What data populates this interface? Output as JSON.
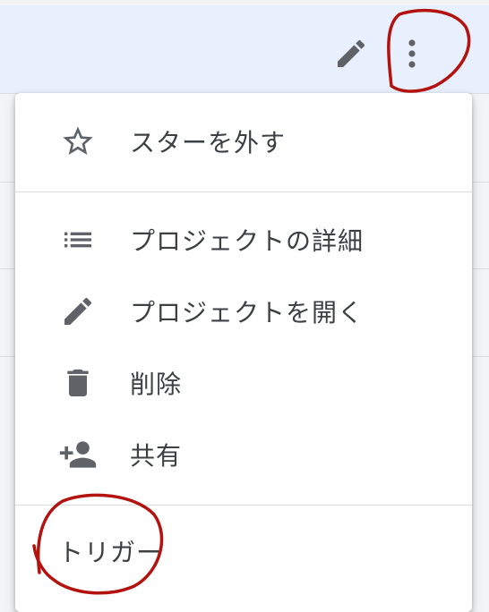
{
  "toolbar": {
    "edit_icon": "pencil-icon",
    "more_icon": "more-vert-icon"
  },
  "menu": {
    "items": [
      {
        "label": "スターを外す",
        "icon": "star-outline-icon"
      },
      {
        "label": "プロジェクトの詳細",
        "icon": "list-icon"
      },
      {
        "label": "プロジェクトを開く",
        "icon": "pencil-icon"
      },
      {
        "label": "削除",
        "icon": "trash-icon"
      },
      {
        "label": "共有",
        "icon": "person-add-icon"
      },
      {
        "label": "トリガー"
      }
    ]
  },
  "colors": {
    "accent_bg": "#e8f0fe",
    "icon": "#5f6368",
    "text": "#3c4043",
    "annotation": "#b3120f"
  }
}
